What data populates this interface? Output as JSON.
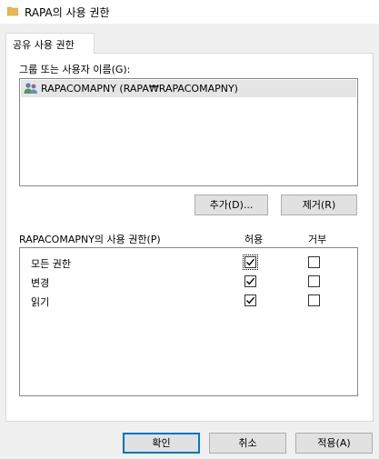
{
  "window": {
    "title": "RAPA의 사용 권한"
  },
  "tabs": [
    {
      "label": "공유 사용 권한"
    }
  ],
  "users_section": {
    "label": "그룹 또는 사용자 이름(G):",
    "users": [
      {
        "name": "RAPACOMAPNY (RAPA₩RAPACOMAPNY)",
        "selected": true,
        "icon": "users-group-icon"
      }
    ],
    "add_button": "추가(D)...",
    "remove_button": "제거(R)"
  },
  "permissions_section": {
    "label": "RAPACOMAPNY의 사용 권한(P)",
    "col_allow": "허용",
    "col_deny": "거부",
    "rows": [
      {
        "name": "모든 권한",
        "allow": true,
        "deny": false
      },
      {
        "name": "변경",
        "allow": true,
        "deny": false
      },
      {
        "name": "읽기",
        "allow": true,
        "deny": false
      }
    ]
  },
  "footer": {
    "ok": "확인",
    "cancel": "취소",
    "apply": "적용(A)"
  },
  "colors": {
    "folder": "#e8b84a",
    "accent": "#0078d7",
    "check": "#000000"
  }
}
